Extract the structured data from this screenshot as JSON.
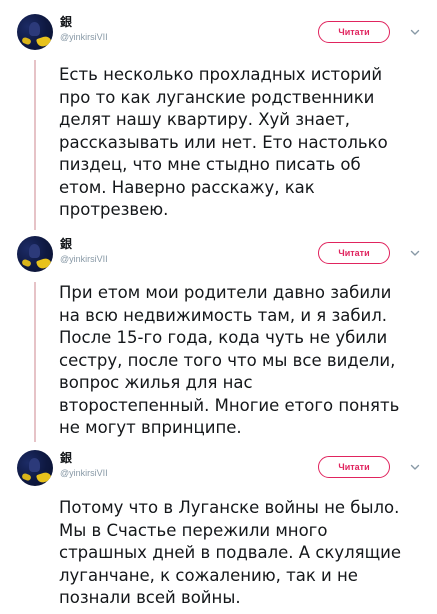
{
  "colors": {
    "accent": "#e0245e",
    "thread_line": "#e6c3c7",
    "muted": "#8899a6",
    "text": "#14171a"
  },
  "tweets": [
    {
      "name": "銀",
      "handle": "@yinkirsiVII",
      "follow_label": "Читати",
      "menu_icon": "chevron-down-icon",
      "text": "Есть несколько прохладных историй\nпро то как луганские родственники\nделят нашу квартиру. Хуй знает,\nрассказывать или нет. Ето настолько\nпиздец, что мне стыдно писать об\nетом. Наверно расскажу, как\nпротрезвею."
    },
    {
      "name": "銀",
      "handle": "@yinkirsiVII",
      "follow_label": "Читати",
      "menu_icon": "chevron-down-icon",
      "text": "При етом мои родители давно забили\nна всю недвижимость там, и я забил.\nПосле 15-го года, кода чуть не убили\nсестру, после того что мы все видели,\nвопрос жилья для нас\nвторостепенный. Многие етого понять\nне могут впринципе."
    },
    {
      "name": "銀",
      "handle": "@yinkirsiVII",
      "follow_label": "Читати",
      "menu_icon": "chevron-down-icon",
      "text": "Потому что в Луганске войны не было.\nМы в Счастье пережили много\nстрашных дней в подвале. А скулящие\nлуганчане, к сожалению, так и не\nпознали всей войны."
    }
  ]
}
